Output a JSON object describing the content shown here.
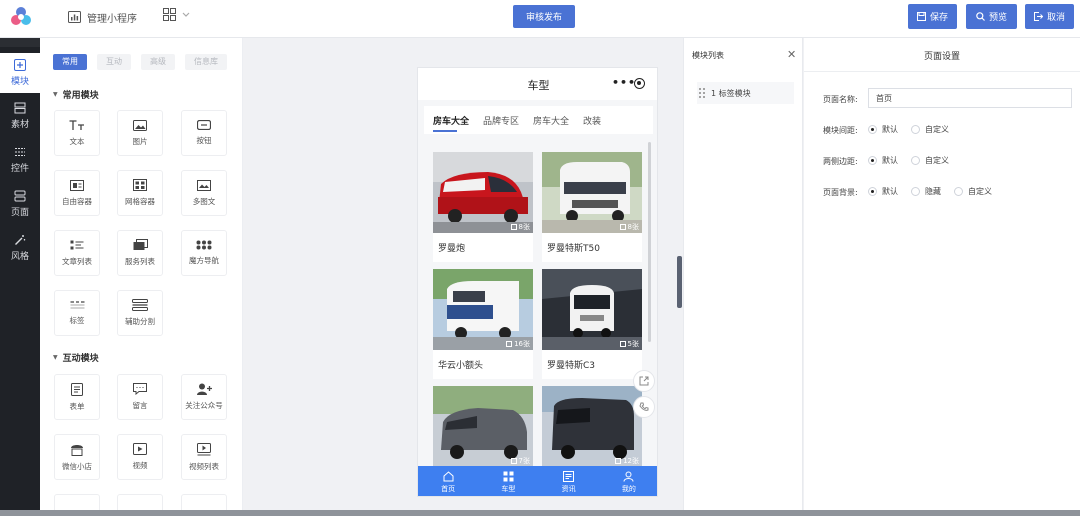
{
  "header": {
    "app_name": "管理小程序",
    "publish_label": "审核发布",
    "save_label": "保存",
    "preview_label": "预览",
    "cancel_label": "取消"
  },
  "left_nav": {
    "items": [
      {
        "label": "模块",
        "icon": "plus-square-icon",
        "active": true
      },
      {
        "label": "素材",
        "icon": "layers-icon"
      },
      {
        "label": "控件",
        "icon": "sliders-icon"
      },
      {
        "label": "页面",
        "icon": "pages-icon"
      },
      {
        "label": "风格",
        "icon": "magic-wand-icon"
      }
    ]
  },
  "component_panel": {
    "tabs": [
      "常用",
      "互动",
      "高级",
      "信息库"
    ],
    "active_tab": "常用",
    "sections": [
      {
        "title": "常用模块",
        "items": [
          {
            "label": "文本",
            "icon": "text-icon"
          },
          {
            "label": "图片",
            "icon": "image-icon"
          },
          {
            "label": "按钮",
            "icon": "button-icon"
          },
          {
            "label": "自由容器",
            "icon": "free-container-icon"
          },
          {
            "label": "网格容器",
            "icon": "grid-container-icon"
          },
          {
            "label": "多图文",
            "icon": "multi-image-text-icon"
          },
          {
            "label": "文章列表",
            "icon": "article-list-icon"
          },
          {
            "label": "服务列表",
            "icon": "service-list-icon"
          },
          {
            "label": "魔方导航",
            "icon": "cube-nav-icon"
          },
          {
            "label": "标签",
            "icon": "tabs-icon"
          },
          {
            "label": "辅助分割",
            "icon": "divider-icon"
          }
        ]
      },
      {
        "title": "互动模块",
        "items": [
          {
            "label": "表单",
            "icon": "form-icon"
          },
          {
            "label": "留言",
            "icon": "message-icon"
          },
          {
            "label": "关注公众号",
            "icon": "follow-account-icon"
          },
          {
            "label": "微信小店",
            "icon": "wechat-shop-icon"
          },
          {
            "label": "视频",
            "icon": "video-icon"
          },
          {
            "label": "视频列表",
            "icon": "video-list-icon"
          }
        ]
      }
    ]
  },
  "phone": {
    "title": "车型",
    "tabs": [
      "房车大全",
      "品牌专区",
      "房车大全",
      "改装"
    ],
    "active_tab": 0,
    "cards": [
      {
        "name": "罗曼炮",
        "count": "8张",
        "color": "#c62828"
      },
      {
        "name": "罗曼特斯T50",
        "count": "8张",
        "color": "#e8e8ea"
      },
      {
        "name": "华云小额头",
        "count": "16张",
        "color": "#f4f4f4"
      },
      {
        "name": "罗曼特斯C3",
        "count": "5张",
        "color": "#ececec"
      },
      {
        "name": "",
        "count": "7张",
        "color": "#5a5d63"
      },
      {
        "name": "",
        "count": "12张",
        "color": "#3a3d44"
      }
    ],
    "tabbar": [
      {
        "label": "首页",
        "icon": "home-icon"
      },
      {
        "label": "车型",
        "icon": "grid-icon"
      },
      {
        "label": "资讯",
        "icon": "news-icon"
      },
      {
        "label": "我的",
        "icon": "user-icon"
      }
    ]
  },
  "module_list": {
    "title": "模块列表",
    "items": [
      "1 标签模块"
    ]
  },
  "page_settings": {
    "title": "页面设置",
    "page_name_label": "页面名称:",
    "page_name_value": "首页",
    "module_gap_label": "模块间距:",
    "module_gap_options": [
      "默认",
      "自定义"
    ],
    "side_margin_label": "两侧边距:",
    "side_margin_options": [
      "默认",
      "自定义"
    ],
    "background_label": "页面背景:",
    "background_options": [
      "默认",
      "隐藏",
      "自定义"
    ]
  },
  "colors": {
    "primary": "#4a72d4",
    "tabbar": "#3e7ff0",
    "sidebar": "#1f2227"
  }
}
